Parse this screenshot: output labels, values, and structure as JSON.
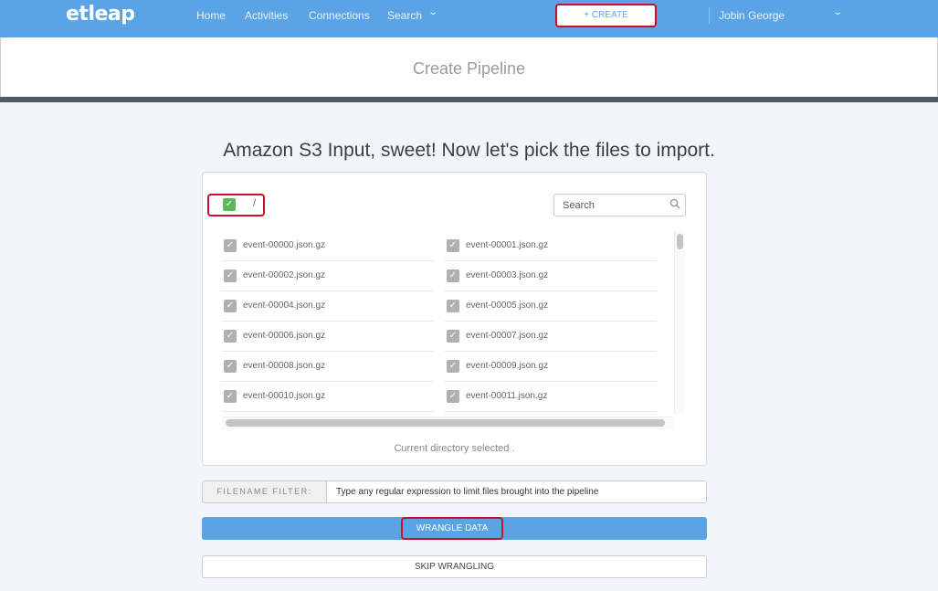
{
  "nav": {
    "logo": "etleap",
    "items": [
      "Home",
      "Activities",
      "Connections",
      "Search"
    ],
    "create_label": "+ CREATE",
    "user_name": "Jobin George",
    "search_chevron_icon": "chevron-down-icon",
    "user_chevron_icon": "chevron-down-icon"
  },
  "page": {
    "title": "Create Pipeline",
    "heading": "Amazon S3 Input, sweet! Now let's pick the files to import."
  },
  "browser": {
    "root_path": "/",
    "root_checked": true,
    "search_placeholder": "Search",
    "files": [
      "event-00000.json.gz",
      "event-00001.json.gz",
      "event-00002.json.gz",
      "event-00003.json.gz",
      "event-00004.json.gz",
      "event-00005.json.gz",
      "event-00006.json.gz",
      "event-00007.json.gz",
      "event-00008.json.gz",
      "event-00009.json.gz",
      "event-00010.json.gz",
      "event-00011.json.gz"
    ],
    "status": "Current directory selected ."
  },
  "filter": {
    "label": "FILENAME FILTER:",
    "placeholder": "Type any regular expression to limit files brought into the pipeline"
  },
  "actions": {
    "wrangle": "WRANGLE DATA",
    "skip": "SKIP WRANGLING"
  },
  "colors": {
    "brand": "#5aa4e6",
    "highlight": "#c8102e",
    "checked_green": "#5cb85c"
  }
}
